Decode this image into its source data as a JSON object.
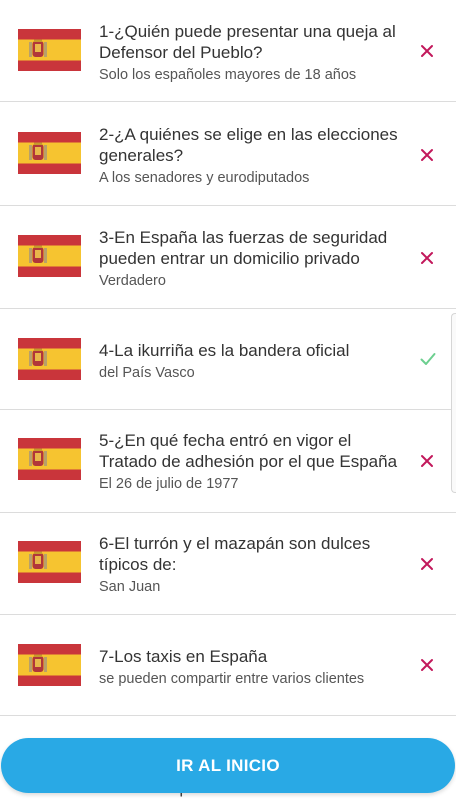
{
  "colors": {
    "flag_red": "#c9353b",
    "flag_yellow": "#f6c430",
    "wrong": "#c2185b",
    "right": "#6ccf8f",
    "button": "#29a9e5"
  },
  "questions": [
    {
      "question": "1-¿Quién puede presentar una queja al Defensor del Pueblo?",
      "answer": "Solo los españoles mayores de 18 años",
      "result": "wrong"
    },
    {
      "question": "2-¿A quiénes se elige en las elecciones generales?",
      "answer": "A los senadores y eurodiputados",
      "result": "wrong"
    },
    {
      "question": "3-En España las fuerzas de seguridad pueden entrar un domicilio privado",
      "answer": "Verdadero",
      "result": "wrong"
    },
    {
      "question": "4-La ikurriña es la bandera oficial",
      "answer": "del País Vasco",
      "result": "right"
    },
    {
      "question": "5-¿En qué fecha entró en vigor el Tratado de adhesión por el que España",
      "answer": "El 26 de julio de 1977",
      "result": "wrong"
    },
    {
      "question": "6-El turrón y el mazapán son dulces típicos de:",
      "answer": "San Juan",
      "result": "wrong"
    },
    {
      "question": "7-Los taxis en España",
      "answer": "se pueden compartir entre varios clientes",
      "result": "wrong"
    }
  ],
  "partial_text": "haber completado el Bachillerato",
  "cta_label": "IR AL INICIO",
  "icons": {
    "flag": "spain-flag-icon",
    "wrong": "cross-icon",
    "right": "check-icon"
  }
}
